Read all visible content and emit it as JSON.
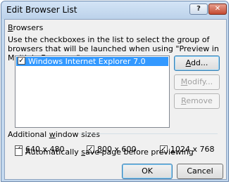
{
  "window": {
    "title": "Edit Browser List",
    "help_glyph": "?",
    "close_glyph": "✕"
  },
  "browsers_section": {
    "label_first": "B",
    "label_rest": "rowsers",
    "description": "Use the checkboxes in the list to select the group of browsers that will be launched when using \"Preview in Multiple Browsers\"",
    "items": [
      {
        "label": "Windows Internet Explorer 7.0",
        "checked": true,
        "check_glyph": "✓"
      }
    ]
  },
  "side_buttons": {
    "add": {
      "first": "A",
      "rest": "dd..."
    },
    "modify": {
      "first": "M",
      "rest": "odify..."
    },
    "remove": {
      "first": "R",
      "rest": "emove"
    }
  },
  "window_sizes": {
    "label_pre": "Additional ",
    "label_u": "w",
    "label_post": "indow sizes",
    "options": [
      {
        "u": "6",
        "rest": "40 x 480",
        "checked": true,
        "check_glyph": "✓"
      },
      {
        "u": "8",
        "rest": "00 x 600",
        "checked": true,
        "check_glyph": "✓"
      },
      {
        "u": "1",
        "rest": "024 x 768",
        "checked": true,
        "check_glyph": "✓"
      }
    ]
  },
  "autosave": {
    "label_pre": "Automatically ",
    "label_u": "s",
    "label_post": "ave page before previewing",
    "checked": false
  },
  "footer": {
    "ok": "OK",
    "cancel": "Cancel"
  },
  "colors": {
    "frame": "#c3d8ee",
    "selection": "#3399ff",
    "client": "#f0f0f0",
    "close_button": "#c44a31"
  }
}
